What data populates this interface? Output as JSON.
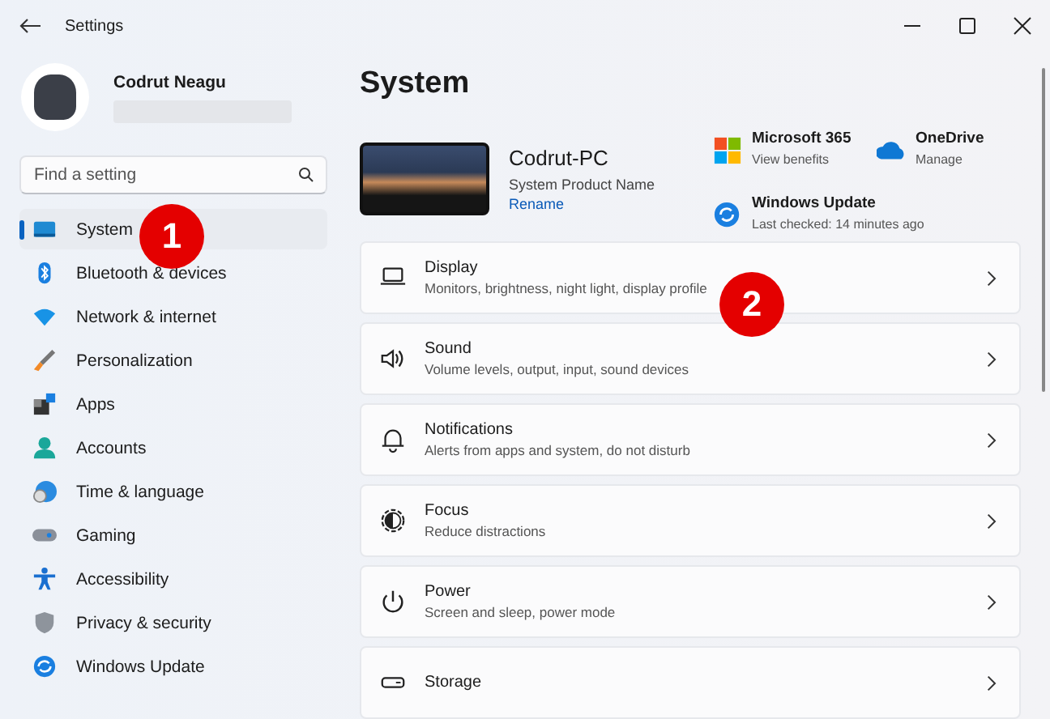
{
  "window": {
    "title": "Settings"
  },
  "profile": {
    "name": "Codrut Neagu"
  },
  "search": {
    "placeholder": "Find a setting"
  },
  "nav": [
    {
      "label": "System",
      "selected": true
    },
    {
      "label": "Bluetooth & devices",
      "selected": false
    },
    {
      "label": "Network & internet",
      "selected": false
    },
    {
      "label": "Personalization",
      "selected": false
    },
    {
      "label": "Apps",
      "selected": false
    },
    {
      "label": "Accounts",
      "selected": false
    },
    {
      "label": "Time & language",
      "selected": false
    },
    {
      "label": "Gaming",
      "selected": false
    },
    {
      "label": "Accessibility",
      "selected": false
    },
    {
      "label": "Privacy & security",
      "selected": false
    },
    {
      "label": "Windows Update",
      "selected": false
    }
  ],
  "page_title": "System",
  "device": {
    "name": "Codrut-PC",
    "model": "System Product Name",
    "rename": "Rename"
  },
  "quick_links": [
    {
      "title": "Microsoft 365",
      "subtitle": "View benefits"
    },
    {
      "title": "OneDrive",
      "subtitle": "Manage"
    },
    {
      "title": "Windows Update",
      "subtitle": "Last checked: 14 minutes ago"
    }
  ],
  "settings": [
    {
      "title": "Display",
      "description": "Monitors, brightness, night light, display profile"
    },
    {
      "title": "Sound",
      "description": "Volume levels, output, input, sound devices"
    },
    {
      "title": "Notifications",
      "description": "Alerts from apps and system, do not disturb"
    },
    {
      "title": "Focus",
      "description": "Reduce distractions"
    },
    {
      "title": "Power",
      "description": "Screen and sleep, power mode"
    },
    {
      "title": "Storage"
    }
  ],
  "callouts": [
    {
      "number": "1"
    },
    {
      "number": "2"
    }
  ]
}
